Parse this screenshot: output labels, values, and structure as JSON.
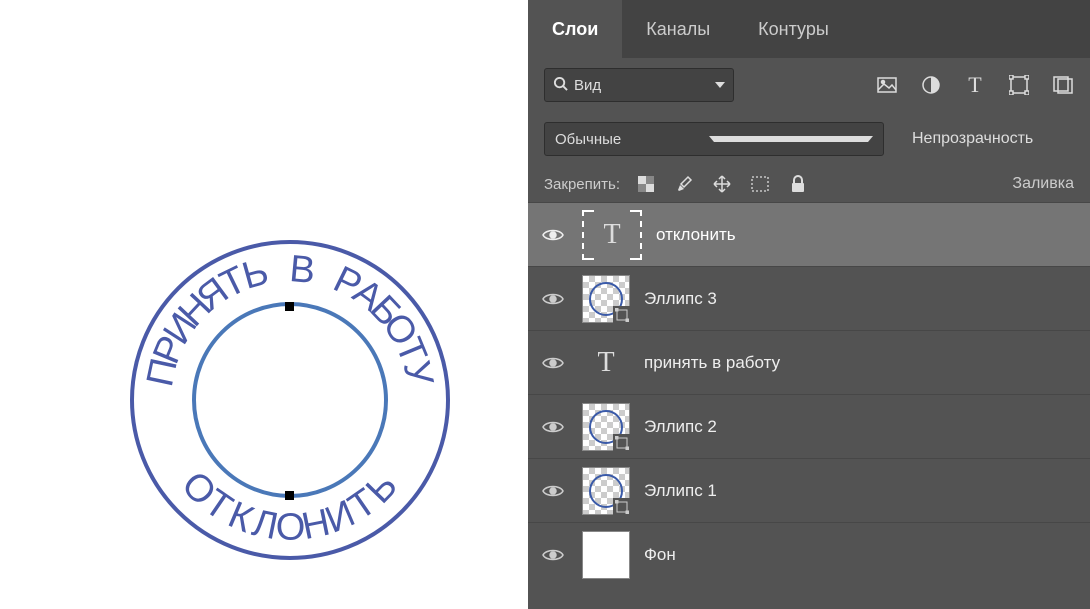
{
  "tabs": {
    "t1": "Слои",
    "t2": "Каналы",
    "t3": "Контуры"
  },
  "search": {
    "label": "Вид"
  },
  "blend": {
    "mode": "Обычные"
  },
  "opacity": {
    "label": "Непрозрачность"
  },
  "lock": {
    "label": "Закрепить:"
  },
  "fill": {
    "label": "Заливка"
  },
  "layers": [
    {
      "name": "отклонить",
      "kind": "text",
      "selected": true
    },
    {
      "name": "Эллипс 3",
      "kind": "shape",
      "selected": false
    },
    {
      "name": "принять в работу",
      "kind": "text-plain",
      "selected": false
    },
    {
      "name": "Эллипс 2",
      "kind": "shape",
      "selected": false
    },
    {
      "name": "Эллипс 1",
      "kind": "shape",
      "selected": false
    },
    {
      "name": "Фон",
      "kind": "bg",
      "selected": false
    }
  ],
  "stamp": {
    "top_text": "ПРИНЯТЬ В РАБОТУ",
    "bottom_text": "ОТКЛОНИТЬ"
  },
  "icons": {
    "image": "image-icon",
    "adjust": "adjust-icon",
    "type": "type-icon",
    "shape": "shape-icon",
    "smart": "smart-icon"
  }
}
